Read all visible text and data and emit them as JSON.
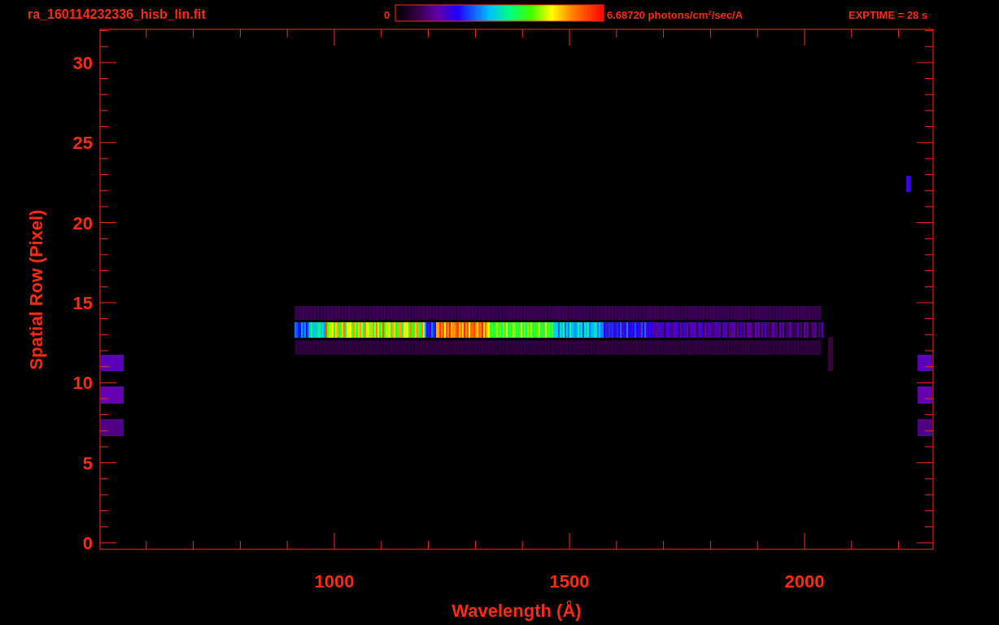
{
  "header": {
    "filename": "ra_160114232336_hisb_lin.fit",
    "colorbar": {
      "min_label": "0",
      "max_label": "6.68720 photons/cm$^{2}$/sec/A"
    },
    "exposure": "EXPTIME = 28 s"
  },
  "plot": {
    "x_axis": {
      "title": "Wavelength (Å)",
      "tick_labels": [
        "1000",
        "1500",
        "2000"
      ]
    },
    "y_axis": {
      "title": "Spatial Row (Pixel)",
      "tick_labels": [
        "30",
        "25",
        "20",
        "15",
        "10",
        "5",
        "0"
      ]
    }
  }
}
